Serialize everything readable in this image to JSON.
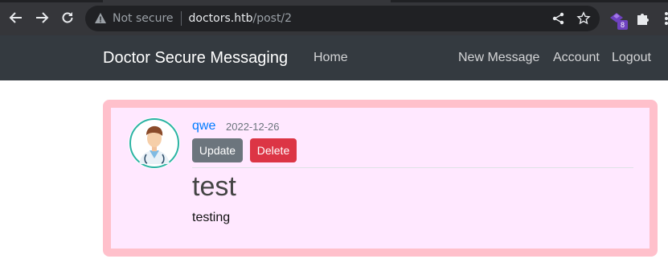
{
  "browser": {
    "security_label": "Not secure",
    "url_host": "doctors.htb",
    "url_path": "/post/2",
    "extension_badge": "8"
  },
  "site": {
    "brand": "Doctor Secure Messaging",
    "nav_left": [
      "Home"
    ],
    "nav_right": [
      "New Message",
      "Account",
      "Logout"
    ]
  },
  "post": {
    "author": "qwe",
    "date": "2022-12-26",
    "update_label": "Update",
    "delete_label": "Delete",
    "title": "test",
    "content": "testing"
  },
  "colors": {
    "navbar_bg": "#343a40",
    "card_bg": "#ffe8ff",
    "card_border": "#ffc0cb",
    "author_link": "#007bff",
    "update_btn": "#6c757d",
    "delete_btn": "#dc3545"
  }
}
